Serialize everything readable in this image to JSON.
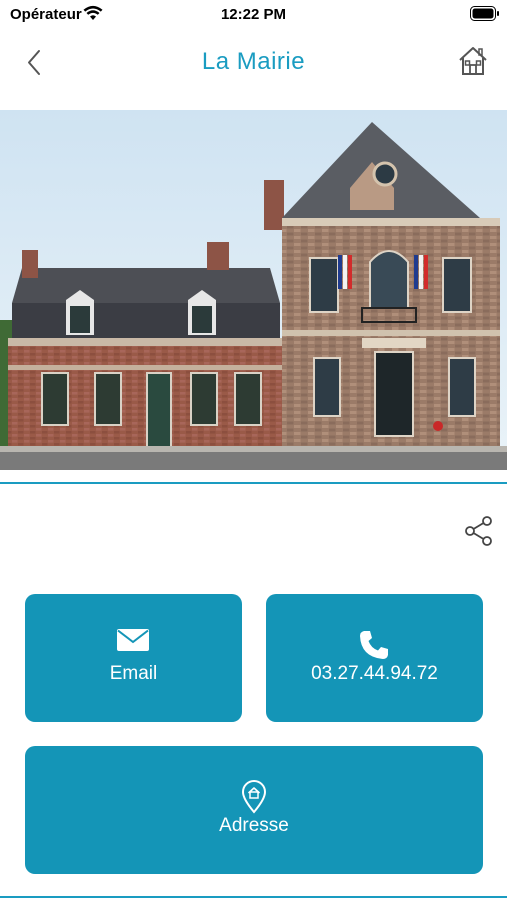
{
  "status_bar": {
    "carrier": "Opérateur",
    "time": "12:22 PM"
  },
  "header": {
    "title": "La Mairie",
    "back_icon": "chevron-left-icon",
    "home_icon": "home-icon"
  },
  "hero": {
    "image_subject": "town-hall-photo"
  },
  "share_icon": "share-icon",
  "actions": {
    "email": {
      "label": "Email",
      "icon": "envelope-icon"
    },
    "phone": {
      "label": "03.27.44.94.72",
      "icon": "phone-icon"
    },
    "address": {
      "label": "Adresse",
      "icon": "location-pin-icon"
    }
  },
  "colors": {
    "accent": "#1a9cc1",
    "tile": "#1495b7"
  }
}
